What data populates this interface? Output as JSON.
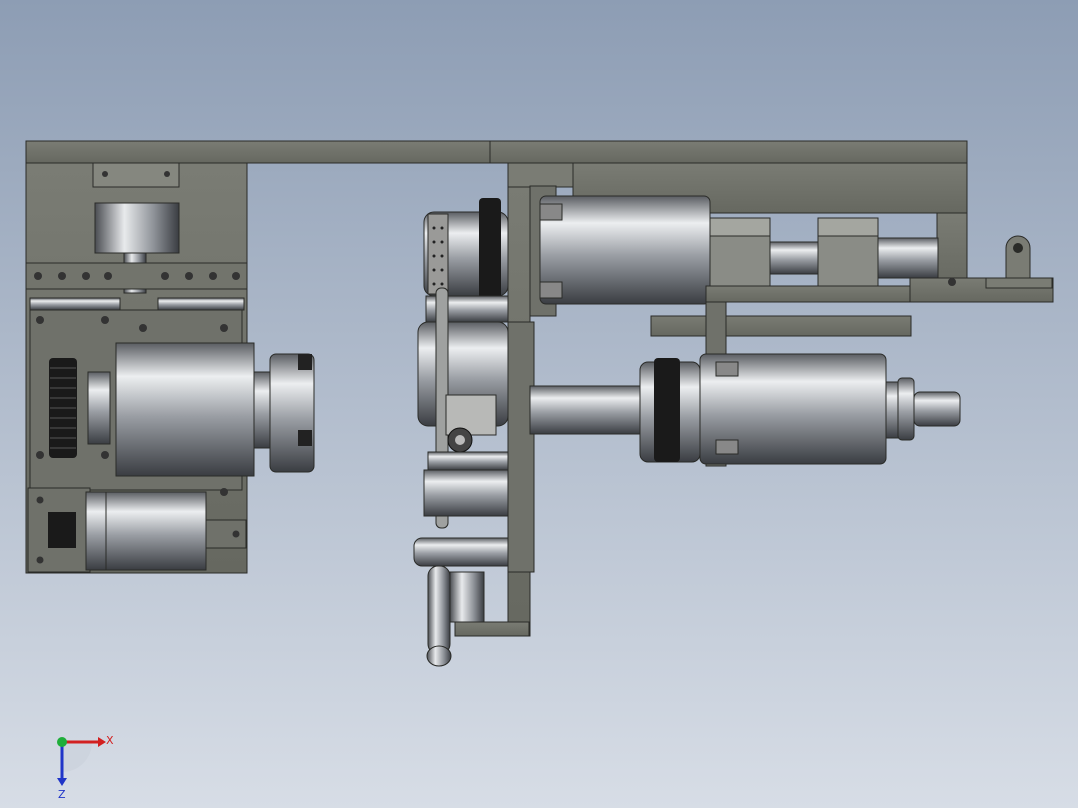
{
  "viewport": {
    "background_top": "#8d9db4",
    "background_bottom": "#d7dde6"
  },
  "model": {
    "frame_color": "#6e7068",
    "frame_edge": "#2a2b28",
    "metal_light": "#e6e8ea",
    "metal_dark": "#3c3f44",
    "gear_color": "#1a1a1a"
  },
  "triad": {
    "x_label": "X",
    "z_label": "Z",
    "x_color": "#d22020",
    "y_color": "#1fae3a",
    "z_color": "#2035c8"
  }
}
